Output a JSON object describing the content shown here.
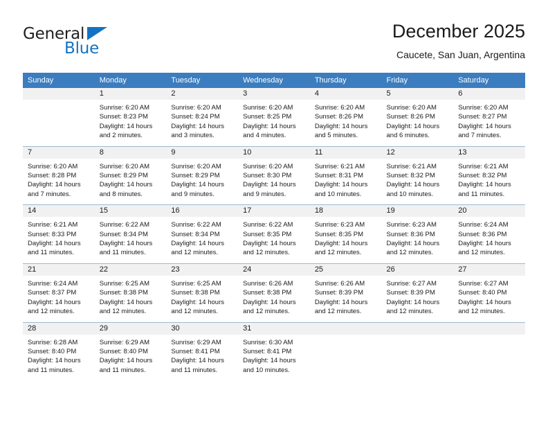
{
  "brand": {
    "name_part1": "General",
    "name_part2": "Blue",
    "triangle_color": "#1273c4"
  },
  "header": {
    "title": "December 2025",
    "subtitle": "Caucete, San Juan, Argentina"
  },
  "theme": {
    "header_bg": "#3b7dbf",
    "daynum_bg": "#f1f1f1",
    "row_divider": "#9fb8cf"
  },
  "weekdays": [
    "Sunday",
    "Monday",
    "Tuesday",
    "Wednesday",
    "Thursday",
    "Friday",
    "Saturday"
  ],
  "weeks": [
    [
      {
        "day": "",
        "lines": []
      },
      {
        "day": "1",
        "lines": [
          "Sunrise: 6:20 AM",
          "Sunset: 8:23 PM",
          "Daylight: 14 hours",
          "and 2 minutes."
        ]
      },
      {
        "day": "2",
        "lines": [
          "Sunrise: 6:20 AM",
          "Sunset: 8:24 PM",
          "Daylight: 14 hours",
          "and 3 minutes."
        ]
      },
      {
        "day": "3",
        "lines": [
          "Sunrise: 6:20 AM",
          "Sunset: 8:25 PM",
          "Daylight: 14 hours",
          "and 4 minutes."
        ]
      },
      {
        "day": "4",
        "lines": [
          "Sunrise: 6:20 AM",
          "Sunset: 8:26 PM",
          "Daylight: 14 hours",
          "and 5 minutes."
        ]
      },
      {
        "day": "5",
        "lines": [
          "Sunrise: 6:20 AM",
          "Sunset: 8:26 PM",
          "Daylight: 14 hours",
          "and 6 minutes."
        ]
      },
      {
        "day": "6",
        "lines": [
          "Sunrise: 6:20 AM",
          "Sunset: 8:27 PM",
          "Daylight: 14 hours",
          "and 7 minutes."
        ]
      }
    ],
    [
      {
        "day": "7",
        "lines": [
          "Sunrise: 6:20 AM",
          "Sunset: 8:28 PM",
          "Daylight: 14 hours",
          "and 7 minutes."
        ]
      },
      {
        "day": "8",
        "lines": [
          "Sunrise: 6:20 AM",
          "Sunset: 8:29 PM",
          "Daylight: 14 hours",
          "and 8 minutes."
        ]
      },
      {
        "day": "9",
        "lines": [
          "Sunrise: 6:20 AM",
          "Sunset: 8:29 PM",
          "Daylight: 14 hours",
          "and 9 minutes."
        ]
      },
      {
        "day": "10",
        "lines": [
          "Sunrise: 6:20 AM",
          "Sunset: 8:30 PM",
          "Daylight: 14 hours",
          "and 9 minutes."
        ]
      },
      {
        "day": "11",
        "lines": [
          "Sunrise: 6:21 AM",
          "Sunset: 8:31 PM",
          "Daylight: 14 hours",
          "and 10 minutes."
        ]
      },
      {
        "day": "12",
        "lines": [
          "Sunrise: 6:21 AM",
          "Sunset: 8:32 PM",
          "Daylight: 14 hours",
          "and 10 minutes."
        ]
      },
      {
        "day": "13",
        "lines": [
          "Sunrise: 6:21 AM",
          "Sunset: 8:32 PM",
          "Daylight: 14 hours",
          "and 11 minutes."
        ]
      }
    ],
    [
      {
        "day": "14",
        "lines": [
          "Sunrise: 6:21 AM",
          "Sunset: 8:33 PM",
          "Daylight: 14 hours",
          "and 11 minutes."
        ]
      },
      {
        "day": "15",
        "lines": [
          "Sunrise: 6:22 AM",
          "Sunset: 8:34 PM",
          "Daylight: 14 hours",
          "and 11 minutes."
        ]
      },
      {
        "day": "16",
        "lines": [
          "Sunrise: 6:22 AM",
          "Sunset: 8:34 PM",
          "Daylight: 14 hours",
          "and 12 minutes."
        ]
      },
      {
        "day": "17",
        "lines": [
          "Sunrise: 6:22 AM",
          "Sunset: 8:35 PM",
          "Daylight: 14 hours",
          "and 12 minutes."
        ]
      },
      {
        "day": "18",
        "lines": [
          "Sunrise: 6:23 AM",
          "Sunset: 8:35 PM",
          "Daylight: 14 hours",
          "and 12 minutes."
        ]
      },
      {
        "day": "19",
        "lines": [
          "Sunrise: 6:23 AM",
          "Sunset: 8:36 PM",
          "Daylight: 14 hours",
          "and 12 minutes."
        ]
      },
      {
        "day": "20",
        "lines": [
          "Sunrise: 6:24 AM",
          "Sunset: 8:36 PM",
          "Daylight: 14 hours",
          "and 12 minutes."
        ]
      }
    ],
    [
      {
        "day": "21",
        "lines": [
          "Sunrise: 6:24 AM",
          "Sunset: 8:37 PM",
          "Daylight: 14 hours",
          "and 12 minutes."
        ]
      },
      {
        "day": "22",
        "lines": [
          "Sunrise: 6:25 AM",
          "Sunset: 8:38 PM",
          "Daylight: 14 hours",
          "and 12 minutes."
        ]
      },
      {
        "day": "23",
        "lines": [
          "Sunrise: 6:25 AM",
          "Sunset: 8:38 PM",
          "Daylight: 14 hours",
          "and 12 minutes."
        ]
      },
      {
        "day": "24",
        "lines": [
          "Sunrise: 6:26 AM",
          "Sunset: 8:38 PM",
          "Daylight: 14 hours",
          "and 12 minutes."
        ]
      },
      {
        "day": "25",
        "lines": [
          "Sunrise: 6:26 AM",
          "Sunset: 8:39 PM",
          "Daylight: 14 hours",
          "and 12 minutes."
        ]
      },
      {
        "day": "26",
        "lines": [
          "Sunrise: 6:27 AM",
          "Sunset: 8:39 PM",
          "Daylight: 14 hours",
          "and 12 minutes."
        ]
      },
      {
        "day": "27",
        "lines": [
          "Sunrise: 6:27 AM",
          "Sunset: 8:40 PM",
          "Daylight: 14 hours",
          "and 12 minutes."
        ]
      }
    ],
    [
      {
        "day": "28",
        "lines": [
          "Sunrise: 6:28 AM",
          "Sunset: 8:40 PM",
          "Daylight: 14 hours",
          "and 11 minutes."
        ]
      },
      {
        "day": "29",
        "lines": [
          "Sunrise: 6:29 AM",
          "Sunset: 8:40 PM",
          "Daylight: 14 hours",
          "and 11 minutes."
        ]
      },
      {
        "day": "30",
        "lines": [
          "Sunrise: 6:29 AM",
          "Sunset: 8:41 PM",
          "Daylight: 14 hours",
          "and 11 minutes."
        ]
      },
      {
        "day": "31",
        "lines": [
          "Sunrise: 6:30 AM",
          "Sunset: 8:41 PM",
          "Daylight: 14 hours",
          "and 10 minutes."
        ]
      },
      {
        "day": "",
        "lines": []
      },
      {
        "day": "",
        "lines": []
      },
      {
        "day": "",
        "lines": []
      }
    ]
  ]
}
